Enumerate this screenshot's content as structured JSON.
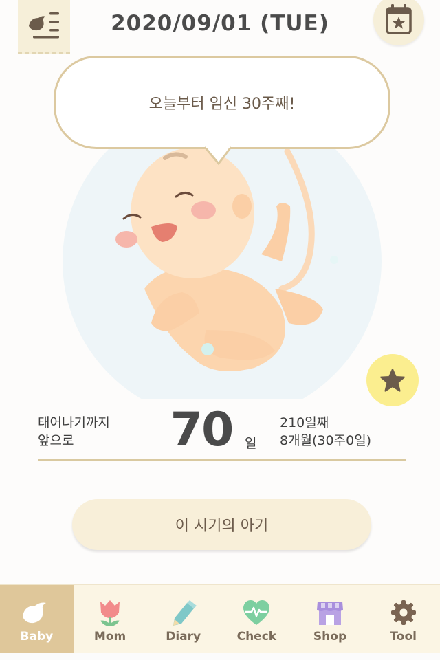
{
  "header": {
    "date": "2020/09/01 (TUE)",
    "menu_icon": "bird-list-icon",
    "calendar_icon": "calendar-star-icon"
  },
  "bubble": {
    "text": "오늘부터 임신 30주째!"
  },
  "countdown": {
    "label_line1": "태어나기까지",
    "label_line2": "앞으로",
    "days_left": "70",
    "unit": "일",
    "day_count": "210일째",
    "month_week": "8개월(30주0일)"
  },
  "main_button": {
    "label": "이 시기의 아기"
  },
  "favorite": {
    "icon": "star-icon"
  },
  "nav": {
    "items": [
      {
        "label": "Baby",
        "icon": "bird-icon",
        "active": true
      },
      {
        "label": "Mom",
        "icon": "tulip-icon",
        "active": false
      },
      {
        "label": "Diary",
        "icon": "pencil-icon",
        "active": false
      },
      {
        "label": "Check",
        "icon": "heartbeat-icon",
        "active": false
      },
      {
        "label": "Shop",
        "icon": "shop-icon",
        "active": false
      },
      {
        "label": "Tool",
        "icon": "gear-icon",
        "active": false
      }
    ]
  },
  "colors": {
    "accent": "#dfc79a",
    "nav_bg": "#fbf5e4",
    "button_bg": "#f8efd9",
    "favorite_bg": "#fbee8f",
    "text_dark": "#4a4a4a"
  }
}
